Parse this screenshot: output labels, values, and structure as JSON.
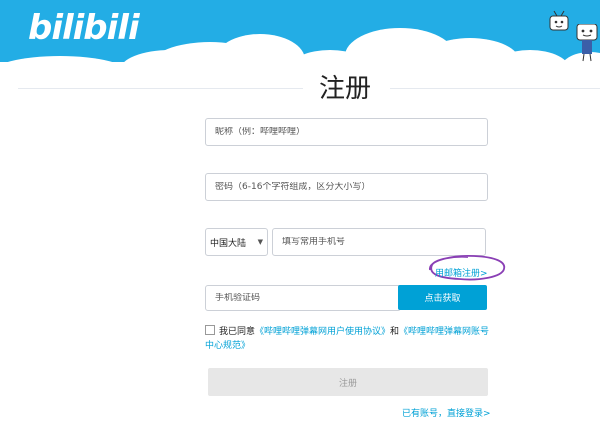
{
  "header": {
    "logo_text": "bilibili",
    "brand_color": "#23ade5"
  },
  "page_title": "注册",
  "form": {
    "nickname_placeholder": "昵称（例：哔哩哔哩）",
    "password_placeholder": "密码（6-16个字符组成，区分大小写）",
    "region_selected": "中国大陆",
    "phone_placeholder": "填写常用手机号",
    "email_register_label": "用邮箱注册>",
    "sms_code_placeholder": "手机验证码",
    "get_code_label": "点击获取",
    "agreement": {
      "prefix": "我已同意",
      "user_agreement": "《哔哩哔哩弹幕网用户使用协议》",
      "and": "和",
      "account_rules": "《哔哩哔哩弹幕网账号中心规范》"
    },
    "register_label": "注册",
    "login_link_label": "已有账号，直接登录>"
  },
  "colors": {
    "link": "#00a1d6",
    "button_primary": "#00a1d6",
    "button_disabled": "#e7e7e7",
    "annotation": "#8a3fb5"
  }
}
